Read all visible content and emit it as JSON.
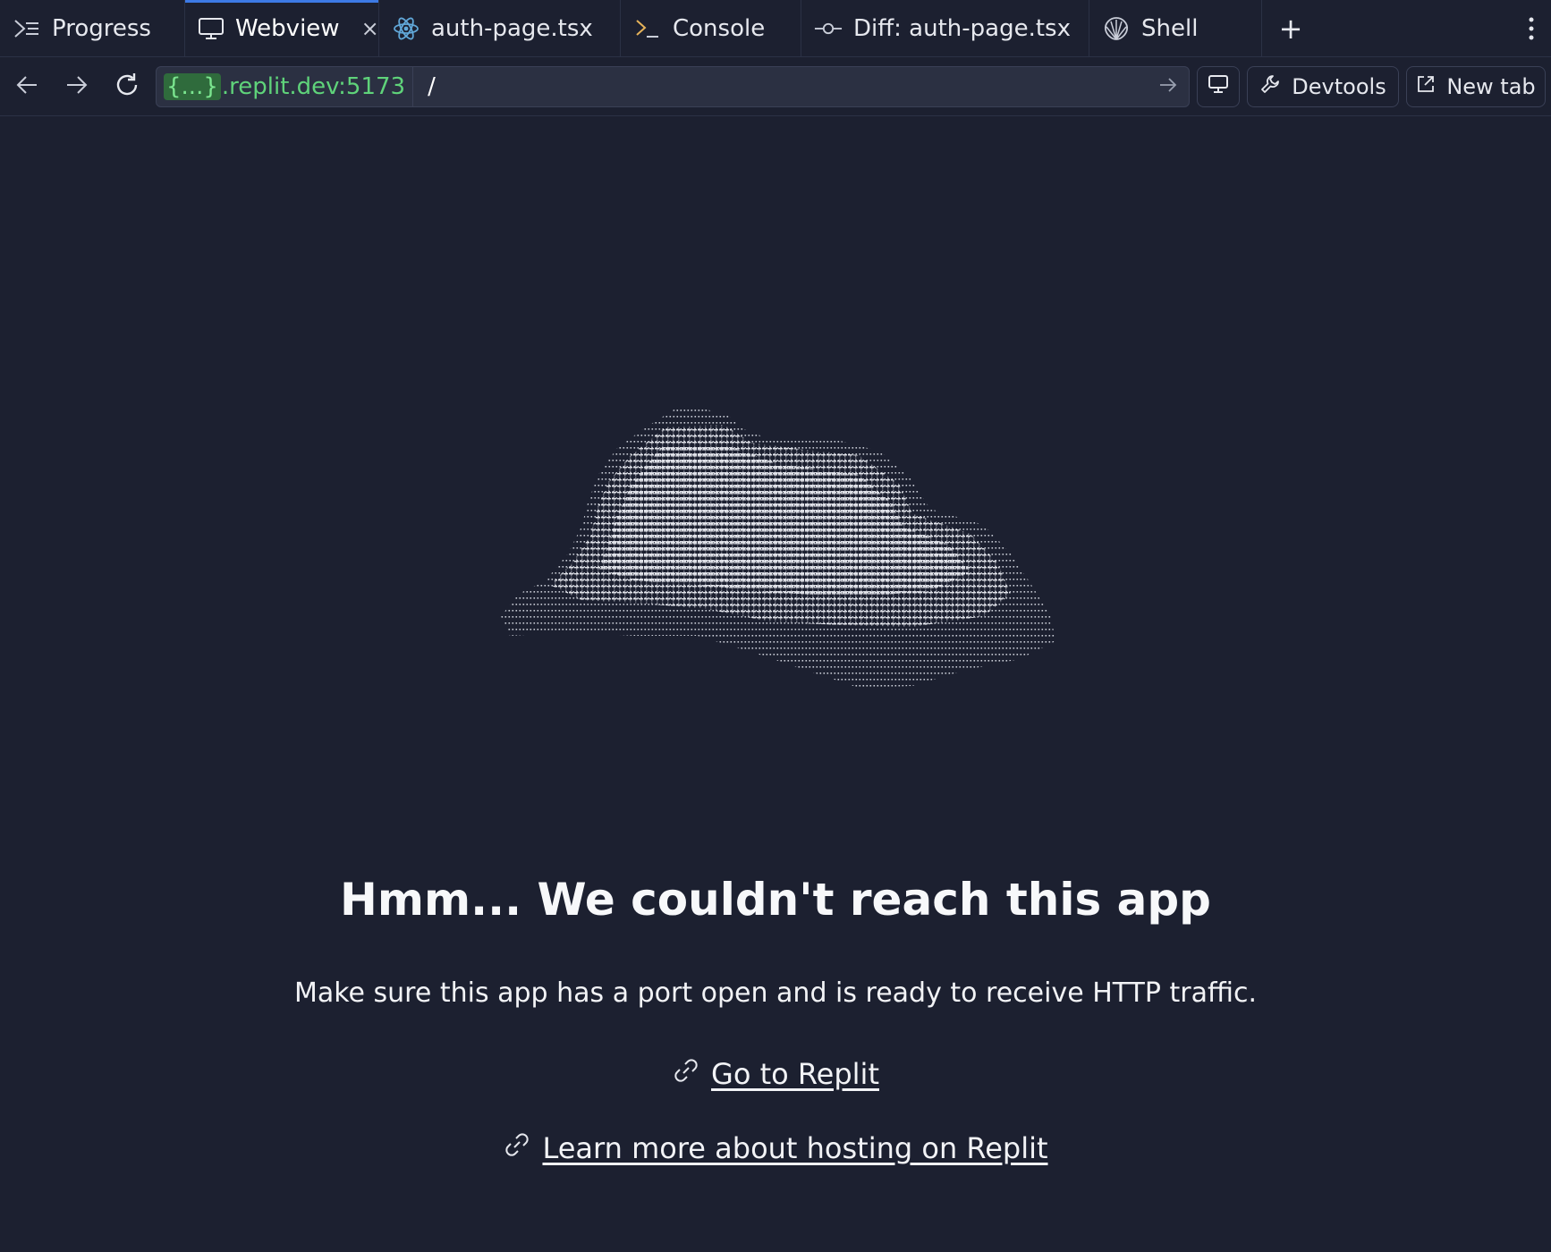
{
  "tabs": [
    {
      "label": "Progress",
      "icon": "progress-icon",
      "active": false
    },
    {
      "label": "Webview",
      "icon": "monitor-icon",
      "active": true,
      "closable": true
    },
    {
      "label": "auth-page.tsx",
      "icon": "react-icon",
      "active": false
    },
    {
      "label": "Console",
      "icon": "terminal-icon",
      "active": false
    },
    {
      "label": "Diff: auth-page.tsx",
      "icon": "git-commit-icon",
      "active": false
    },
    {
      "label": "Shell",
      "icon": "shell-icon",
      "active": false
    }
  ],
  "tab_add_label": "+",
  "tab_close_label": "×",
  "url": {
    "host_prefix": "{...}",
    "host_suffix": ".replit.dev:5173",
    "path": "/"
  },
  "toolbar": {
    "devtools_label": "Devtools",
    "new_tab_label": "New tab"
  },
  "page": {
    "heading": "Hmm... We couldn't reach this app",
    "message": "Make sure this app has a port open and is ready to receive HTTP traffic.",
    "links": [
      {
        "label": "Go to Replit"
      },
      {
        "label": "Learn more about hosting on Replit"
      }
    ]
  },
  "colors": {
    "background": "#1c2030",
    "accent": "#3d7ae5",
    "host_green": "#5fd37a",
    "react_blue": "#61a8d9"
  }
}
